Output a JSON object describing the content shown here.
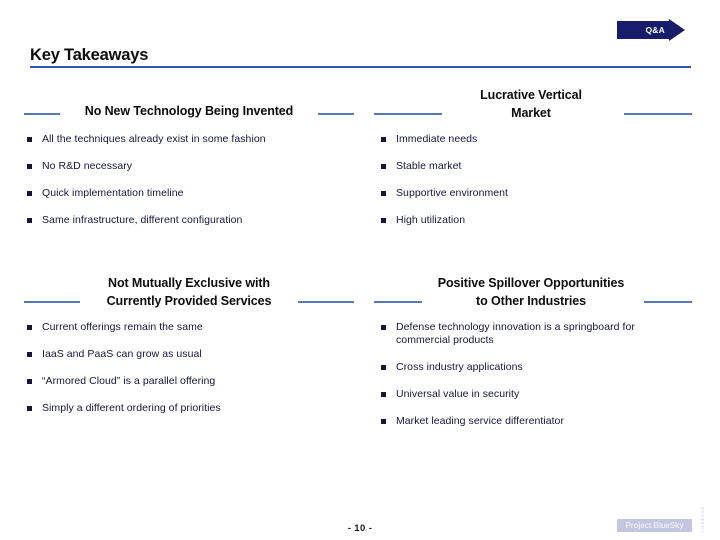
{
  "nav": {
    "qa_tab_label": "Q&A"
  },
  "header": {
    "title": "Key Takeaways"
  },
  "colors": {
    "accent_rule": "#2f58a7",
    "section_rule": "#5878b4",
    "tab_navy": "#171c6b",
    "body_text": "#16163a",
    "badge_bg": "#c3c6e0"
  },
  "sections": [
    {
      "id": "no-new-technology",
      "heading_lines": [
        "No New Technology Being Invented"
      ],
      "bullets": [
        "All the techniques already exist in some fashion",
        "No R&D necessary",
        "Quick implementation timeline",
        "Same infrastructure, different configuration"
      ]
    },
    {
      "id": "lucrative-vertical-market",
      "heading_lines": [
        "Lucrative Vertical",
        "Market"
      ],
      "bullets": [
        "Immediate needs",
        "Stable market",
        "Supportive environment",
        "High utilization"
      ]
    },
    {
      "id": "not-mutually-exclusive",
      "heading_lines": [
        "Not Mutually Exclusive with",
        "Currently Provided Services"
      ],
      "bullets": [
        "Current offerings remain the same",
        "IaaS and PaaS can grow as usual",
        "“Armored Cloud” is a parallel offering",
        "Simply a different ordering of priorities"
      ]
    },
    {
      "id": "positive-spillover",
      "heading_lines": [
        "Positive Spillover Opportunities",
        "to Other Industries"
      ],
      "bullets": [
        "Defense technology innovation is a springboard for commercial products",
        "Cross industry applications",
        "Universal value in security",
        "Market leading service differentiator"
      ]
    }
  ],
  "footer": {
    "page_number": "- 10 -",
    "brand": "Project BlueSky",
    "side_watermark": "Confidential"
  }
}
